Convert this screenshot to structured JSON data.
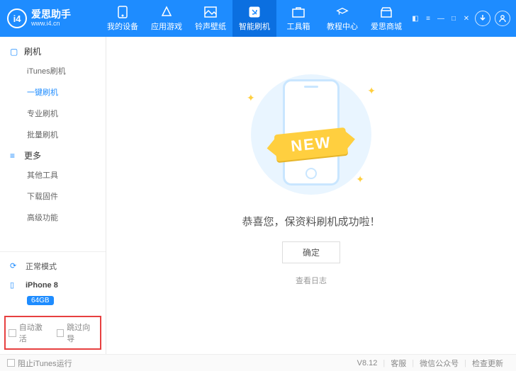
{
  "header": {
    "logo_text": "i4",
    "brand": "爱思助手",
    "url": "www.i4.cn",
    "tabs": [
      {
        "label": "我的设备"
      },
      {
        "label": "应用游戏"
      },
      {
        "label": "铃声壁纸"
      },
      {
        "label": "智能刷机"
      },
      {
        "label": "工具箱"
      },
      {
        "label": "教程中心"
      },
      {
        "label": "爱思商城"
      }
    ]
  },
  "sidebar": {
    "group1": {
      "title": "刷机",
      "items": [
        "iTunes刷机",
        "一键刷机",
        "专业刷机",
        "批量刷机"
      ]
    },
    "group2": {
      "title": "更多",
      "items": [
        "其他工具",
        "下载固件",
        "高级功能"
      ]
    },
    "mode_label": "正常模式",
    "device_name": "iPhone 8",
    "device_storage": "64GB",
    "auto_activate": "自动激活",
    "skip_guide": "跳过向导"
  },
  "main": {
    "ribbon": "NEW",
    "success_msg": "恭喜您，保资料刷机成功啦！",
    "ok_btn": "确定",
    "view_log": "查看日志"
  },
  "footer": {
    "block_itunes": "阻止iTunes运行",
    "version": "V8.12",
    "support": "客服",
    "wechat": "微信公众号",
    "check_update": "检查更新"
  }
}
